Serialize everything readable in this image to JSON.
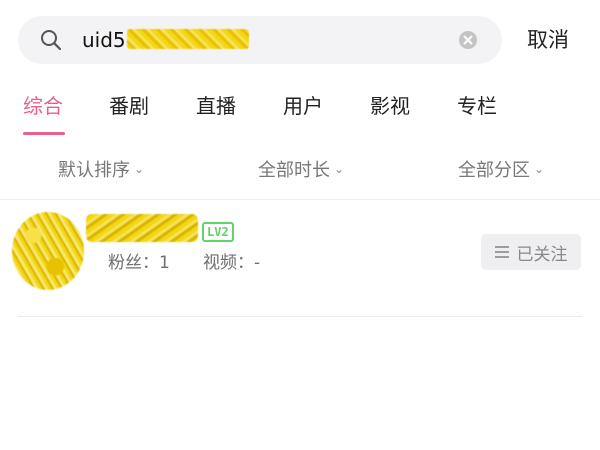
{
  "search": {
    "value": "uid5",
    "icon": "search-icon",
    "clear_icon": "clear-icon"
  },
  "header": {
    "cancel_label": "取消"
  },
  "tabs": [
    {
      "label": "综合",
      "active": true
    },
    {
      "label": "番剧"
    },
    {
      "label": "直播"
    },
    {
      "label": "用户"
    },
    {
      "label": "影视"
    },
    {
      "label": "专栏"
    }
  ],
  "filters": [
    {
      "label": "默认排序",
      "icon": "chevron-down-icon"
    },
    {
      "label": "全部时长",
      "icon": "chevron-down-icon"
    },
    {
      "label": "全部分区",
      "icon": "chevron-down-icon"
    }
  ],
  "results": [
    {
      "level": "LV2",
      "fans_label": "粉丝：1",
      "videos_label": "视频：-",
      "follow_label": "已关注"
    }
  ],
  "colors": {
    "accent": "#e8608f",
    "level_green": "#5fd46a",
    "redaction": "#f3d614"
  }
}
